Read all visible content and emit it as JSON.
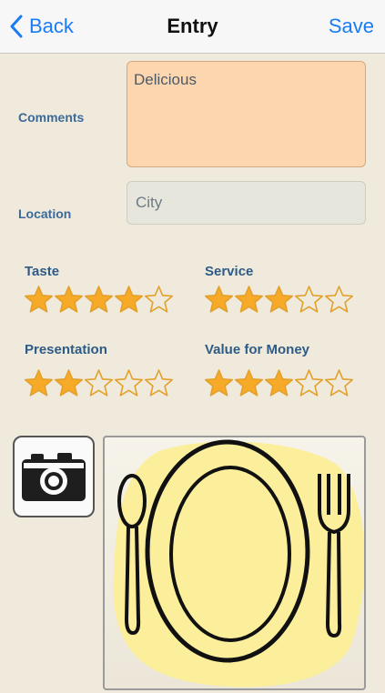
{
  "nav": {
    "back_label": "Back",
    "title": "Entry",
    "save_label": "Save"
  },
  "form": {
    "comments_label": "Comments",
    "comments_value": "Delicious",
    "location_label": "Location",
    "location_placeholder": "City"
  },
  "ratings": [
    {
      "label": "Taste",
      "value": 4,
      "max": 5
    },
    {
      "label": "Service",
      "value": 3,
      "max": 5
    },
    {
      "label": "Presentation",
      "value": 2,
      "max": 5
    },
    {
      "label": "Value for Money",
      "value": 3,
      "max": 5
    }
  ],
  "colors": {
    "accent": "#1a7cf5",
    "star_fill": "#f7a928",
    "star_outline": "#e3a12b",
    "comments_bg": "#fcd6ae",
    "plate_blob": "#fbef9b"
  },
  "icons": {
    "back": "chevron-left-icon",
    "camera": "camera-icon",
    "photo": "plate-fork-spoon-icon"
  }
}
